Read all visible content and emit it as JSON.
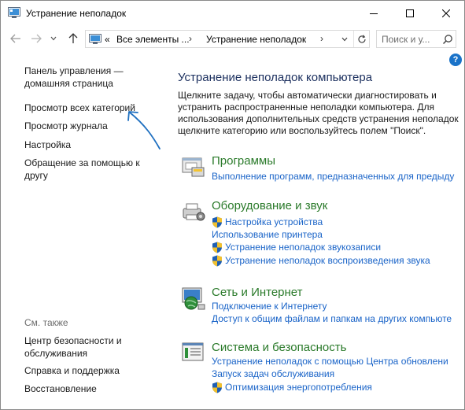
{
  "window": {
    "title": "Устранение неполадок"
  },
  "address": {
    "overflow": "«",
    "crumbs": [
      "Все элементы ...",
      "Устранение неполадок"
    ],
    "separator": "›"
  },
  "search": {
    "placeholder": "Поиск и у..."
  },
  "help_label": "?",
  "sidebar": {
    "home_line1": "Панель управления —",
    "home_line2": "домашняя страница",
    "links": [
      "Просмотр всех категорий",
      "Просмотр журнала",
      "Настройка",
      "Обращение за помощью к другу"
    ],
    "help_line1": "Обращение за помощью к",
    "help_line2": "другу",
    "see_also": "См. также",
    "security_line1": "Центр безопасности и",
    "security_line2": "обслуживания",
    "support": "Справка и поддержка",
    "restore": "Восстановление"
  },
  "main": {
    "title": "Устранение неполадок компьютера",
    "description": "Щелкните задачу, чтобы автоматически диагностировать и устранить распространенные неполадки компьютера. Для использования дополнительных средств устранения неполадок щелкните категорию или воспользуйтесь полем \"Поиск\".",
    "categories": [
      {
        "title": "Программы",
        "icon": "programs-icon",
        "links": [
          {
            "label": "Выполнение программ, предназначенных для предыду",
            "shield": false
          }
        ]
      },
      {
        "title": "Оборудование и звук",
        "icon": "hardware-sound-icon",
        "links": [
          {
            "label": "Настройка устройства",
            "shield": true
          },
          {
            "label": "Использование принтера",
            "shield": false
          },
          {
            "label": "Устранение неполадок звукозаписи",
            "shield": true
          },
          {
            "label": "Устранение неполадок воспроизведения звука",
            "shield": true
          }
        ]
      },
      {
        "title": "Сеть и Интернет",
        "icon": "network-icon",
        "links": [
          {
            "label": "Подключение к Интернету",
            "shield": false
          },
          {
            "label": "Доступ к общим файлам и папкам на других компьюте",
            "shield": false
          }
        ]
      },
      {
        "title": "Система и безопасность",
        "icon": "system-security-icon",
        "links": [
          {
            "label": "Устранение неполадок с помощью Центра обновлени",
            "shield": false
          },
          {
            "label": "Запуск задач обслуживания",
            "shield": false
          },
          {
            "label": "Оптимизация энергопотребления",
            "shield": true
          }
        ]
      }
    ]
  },
  "colors": {
    "category_title": "#2a7a2a",
    "link": "#1a64c8",
    "heading": "#1b2f5e",
    "annotation_arrow": "#1e6fc0"
  }
}
